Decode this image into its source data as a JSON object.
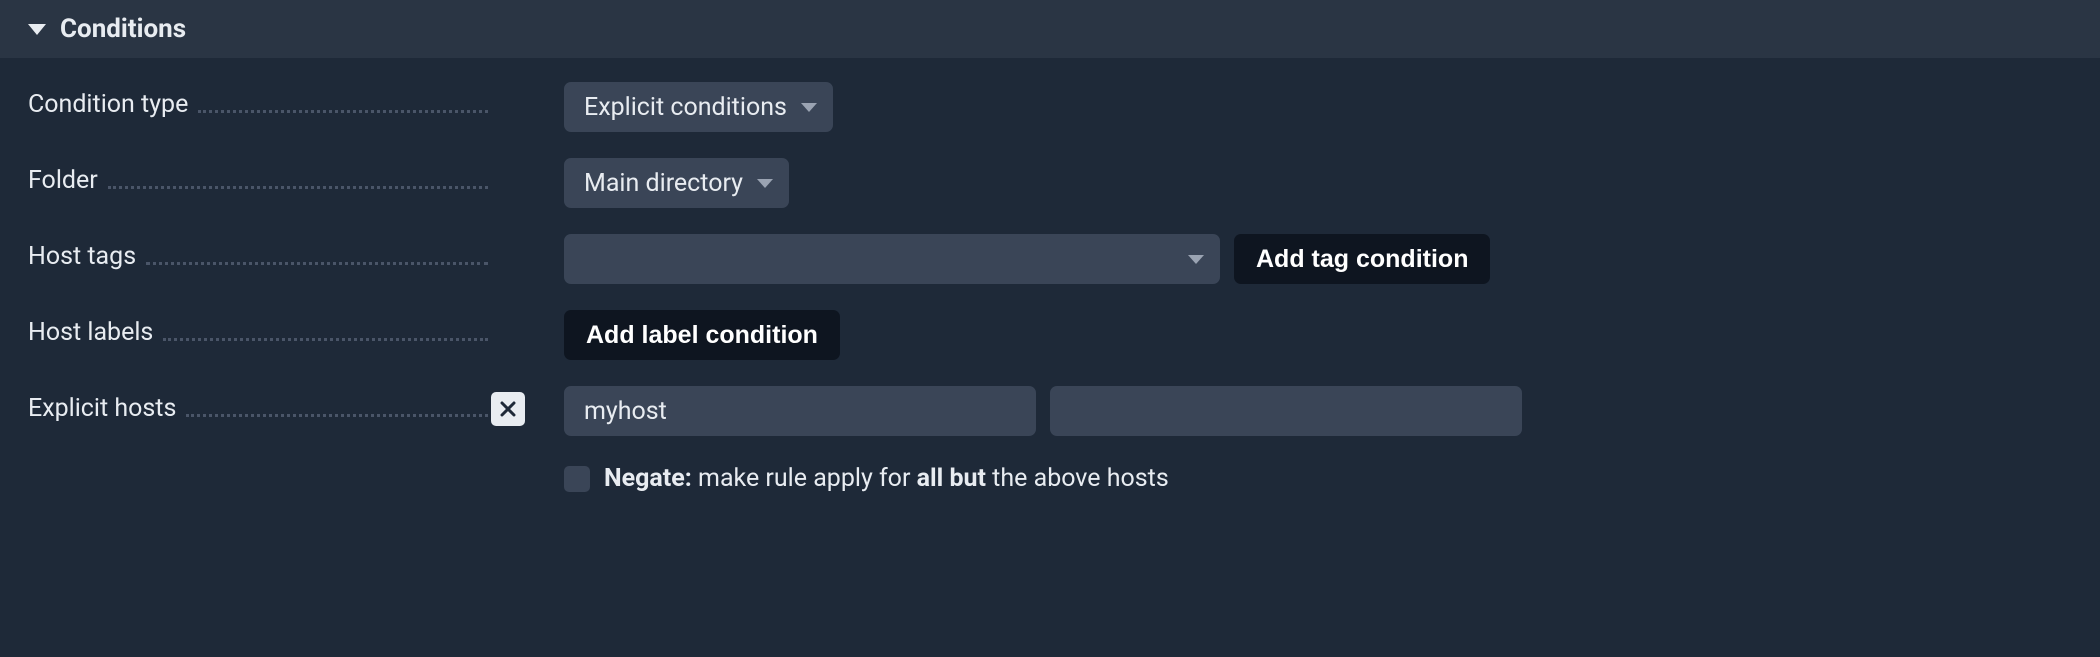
{
  "section": {
    "title": "Conditions"
  },
  "rows": {
    "condition_type": {
      "label": "Condition type",
      "value": "Explicit conditions"
    },
    "folder": {
      "label": "Folder",
      "value": "Main directory"
    },
    "host_tags": {
      "label": "Host tags",
      "value": "",
      "button": "Add tag condition"
    },
    "host_labels": {
      "label": "Host labels",
      "button": "Add label condition"
    },
    "explicit_hosts": {
      "label": "Explicit hosts",
      "input1": "myhost",
      "input2": "",
      "negate_bold": "Negate:",
      "negate_text1": " make rule apply for ",
      "negate_bold2": "all but",
      "negate_text2": " the above hosts"
    }
  }
}
